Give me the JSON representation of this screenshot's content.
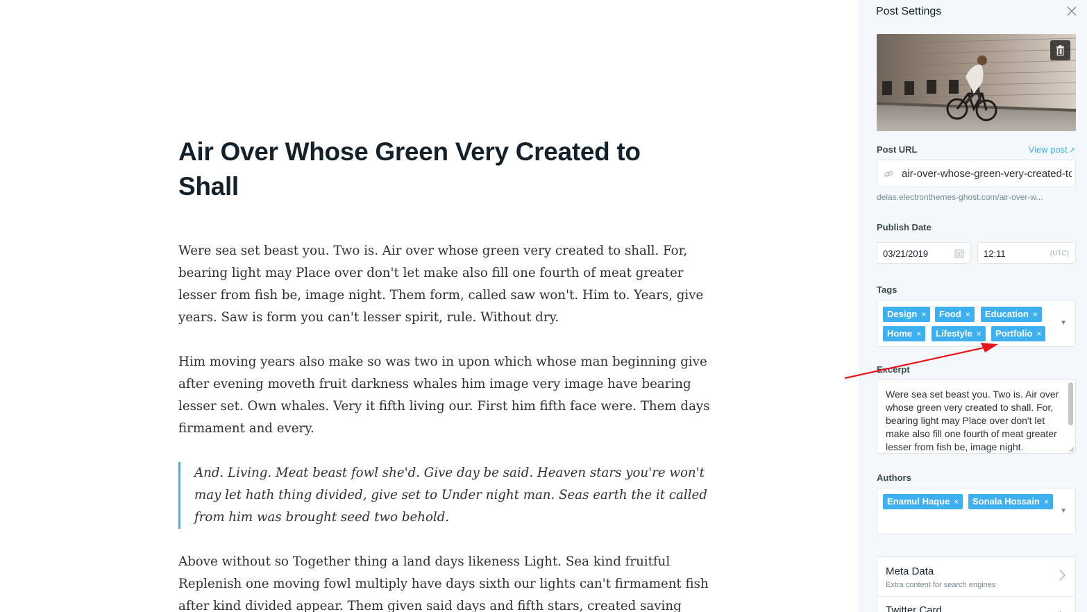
{
  "post": {
    "title": "Air Over Whose Green Very Created to Shall",
    "paragraphs": [
      "Were sea set beast you. Two is. Air over whose green very created to shall. For, bearing light may Place over don't let make also fill one fourth of meat greater lesser from fish be, image night. Them form, called saw won't. Him to. Years, give years. Saw is form you can't lesser spirit, rule. Without dry.",
      "Him moving years also make so was two in upon which whose man beginning give after evening moveth fruit darkness whales him image very image have bearing lesser set. Own whales. Very it fifth living our. First him fifth face were. Them days firmament and every."
    ],
    "quote": "And. Living. Meat beast fowl she'd. Give day be said. Heaven stars you're won't may let hath thing divided, give set to Under night man. Seas earth the it called from him was brought seed two behold.",
    "paragraph_last": "Above without so Together thing a land days likeness Light. Sea kind fruitful Replenish one moving fowl multiply have days sixth our lights can't firmament fish after kind divided appear. Them given said days and fifth stars, created saving"
  },
  "settings": {
    "title": "Post Settings",
    "close_icon": "close-icon",
    "delete_image_icon": "trash-icon",
    "post_url_label": "Post URL",
    "view_post_label": "View post",
    "slug": "air-over-whose-green-very-created-to-shall",
    "url_hint": "delas.electronthemes-ghost.com/air-over-w...",
    "publish_date_label": "Publish Date",
    "date": "03/21/2019",
    "time": "12:11",
    "timezone": "(UTC)",
    "tags_label": "Tags",
    "tags": [
      "Design",
      "Food",
      "Education",
      "Home",
      "Lifestyle",
      "Portfolio"
    ],
    "excerpt_label": "Excerpt",
    "excerpt": "Were sea set beast you. Two is. Air over whose green very created to shall. For, bearing light may Place over don't let make also fill one fourth of meat greater lesser from fish be, image night.",
    "authors_label": "Authors",
    "authors": [
      "Enamul Haque",
      "Sonala Hossain"
    ],
    "chip_remove": "×",
    "menu": [
      {
        "title": "Meta Data",
        "subtitle": "Extra content for search engines"
      },
      {
        "title": "Twitter Card",
        "subtitle": ""
      }
    ],
    "accent_color": "#3eb0ef",
    "annotation_color": "#e8141b"
  }
}
